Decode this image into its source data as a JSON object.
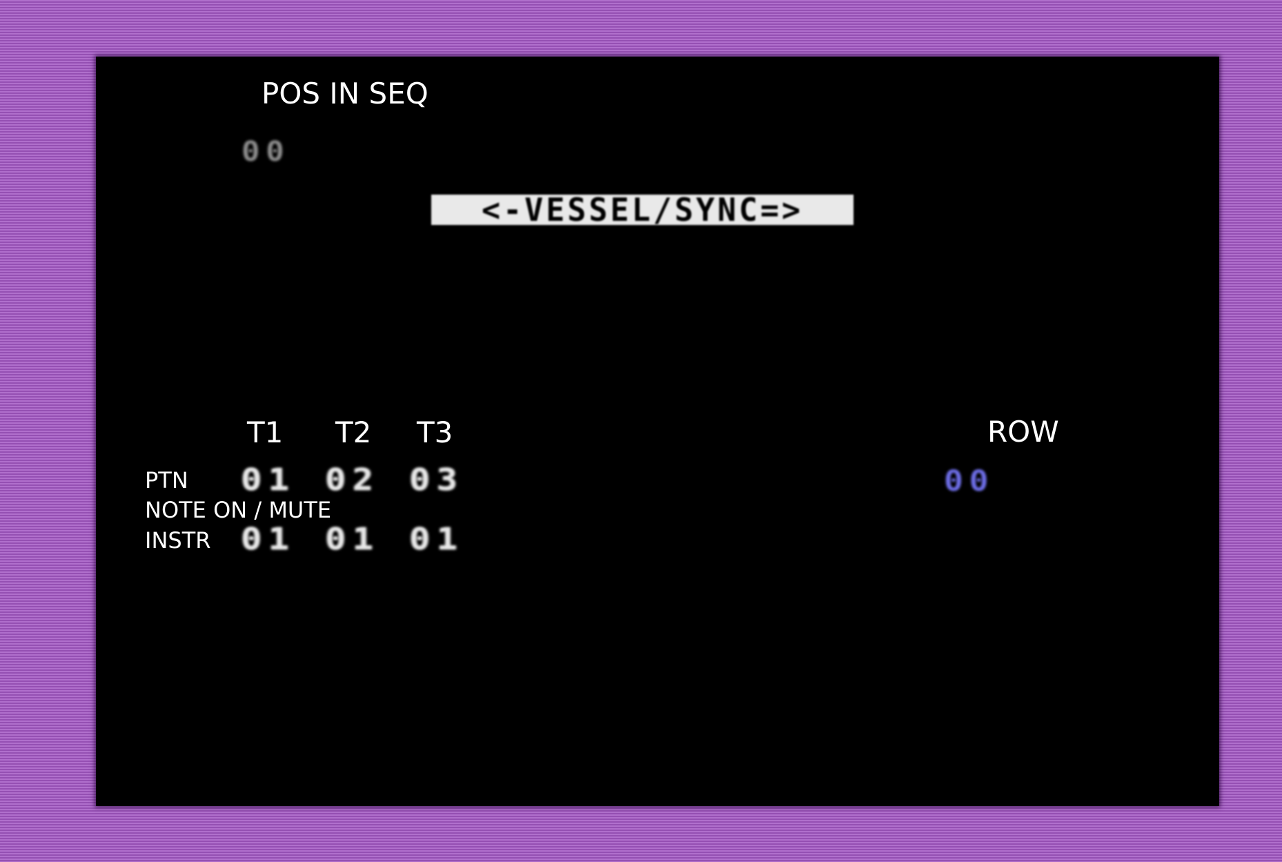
{
  "header": {
    "pos_in_seq_label": "POS IN SEQ",
    "pos_in_seq_value": "00",
    "banner": "<-VESSEL/SYNC=>"
  },
  "tracks": {
    "columns": [
      "T1",
      "T2",
      "T3"
    ],
    "rows": {
      "ptn": {
        "label": "PTN",
        "values": [
          "01",
          "02",
          "03"
        ]
      },
      "note_on_mute": {
        "label": "NOTE ON / MUTE"
      },
      "instr": {
        "label": "INSTR",
        "values": [
          "01",
          "01",
          "01"
        ]
      }
    }
  },
  "row": {
    "label": "ROW",
    "value": "00"
  },
  "colors": {
    "border": "#a562c2",
    "screen": "#000000",
    "text": "#ffffff",
    "row_value": "#6e6ee8",
    "pos_value": "#8d8d8d",
    "banner_bg": "#e9e9e9"
  }
}
